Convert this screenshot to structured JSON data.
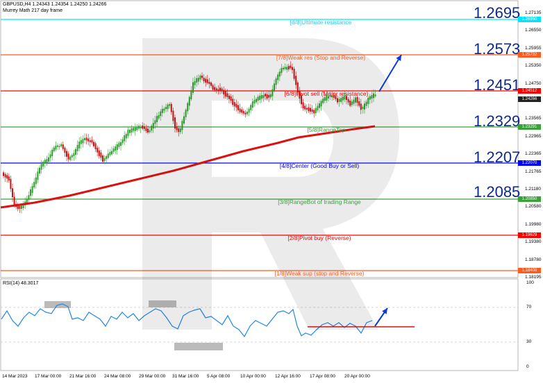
{
  "header": {
    "symbol_line": "GBPUSD,H4  1.24343 1.24354 1.24250 1.24266",
    "indicator_name": "Murrey Math 217 day frame"
  },
  "murrey_levels": [
    {
      "label": "[8/8]Ultimate resistance",
      "value": "1.2695",
      "badge": "1.26950",
      "color": "#00e5ff",
      "label_color": "#2bc8e0"
    },
    {
      "label": "[7/8]Weak res (Stop and Reverse)",
      "value": "1.2573",
      "badge": "1.25732",
      "color": "#ff5a1f",
      "label_color": "#ff5a1f"
    },
    {
      "label": "[6/8]Pivot sell (Major resistance)",
      "value": "1.2451",
      "badge": "1.24512",
      "color": "#ff0000",
      "label_color": "#ff0000"
    },
    {
      "label": "[5/8]RangeTop",
      "value": "1.2329",
      "badge": "1.23291",
      "color": "#3aa03a",
      "label_color": "#3aa03a"
    },
    {
      "label": "[4/8]Center (Good Buy or Sell)",
      "value": "1.2207",
      "badge": "1.22070",
      "color": "#0000ff",
      "label_color": "#0000ff"
    },
    {
      "label": "[3/8]RangeBot of trading Range",
      "value": "1.2085",
      "badge": "1.20850",
      "color": "#3aa03a",
      "label_color": "#3aa03a"
    },
    {
      "label": "[2/8]Pivot buy (Reverse)",
      "value": "",
      "badge": "1.19629",
      "color": "#ff0000",
      "label_color": "#ff0000"
    },
    {
      "label": "[1/8]Weak sup (stop and Reverse)",
      "value": "",
      "badge": "1.18408",
      "color": "#ff5a1f",
      "label_color": "#ff5a1f"
    }
  ],
  "current_price_badge": "1.24266",
  "price_axis_ticks": [
    "1.27135",
    "1.26550",
    "1.25955",
    "1.25350",
    "1.24750",
    "1.24165",
    "1.23565",
    "1.22965",
    "1.22365",
    "1.21765",
    "1.21180",
    "1.20580",
    "1.19980",
    "1.19380",
    "1.18780",
    "1.18195"
  ],
  "time_axis_ticks": [
    "14 Mar 2023",
    "17 Mar 00:00",
    "21 Mar 16:00",
    "24 Mar 08:00",
    "29 Mar 00:00",
    "31 Mar 16:00",
    "5 Apr 08:00",
    "10 Apr 00:00",
    "12 Apr 16:00",
    "17 Apr 08:00",
    "20 Apr 00:00"
  ],
  "rsi": {
    "label": "RSI(14) 48.3017",
    "ticks": [
      "100",
      "70",
      "30",
      "0"
    ]
  },
  "colors": {
    "bull_candle": "#2ba02b",
    "bear_candle": "#cc1010",
    "moving_average": "#dd1111",
    "rsi_line": "#1e88e5",
    "arrow": "#0b3bd6"
  }
}
